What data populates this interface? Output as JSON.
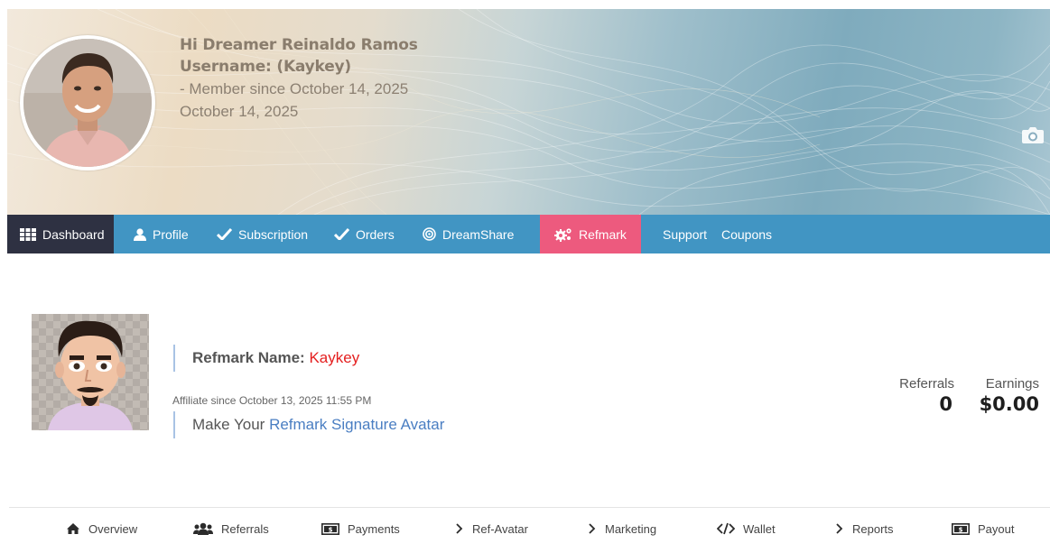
{
  "header": {
    "greeting": "Hi Dreamer Reinaldo  Ramos",
    "username": "Username: (Kaykey)",
    "member_since": "- Member since October 14, 2025",
    "date": "October 14, 2025"
  },
  "nav": {
    "items": [
      {
        "label": "Dashboard",
        "icon": "grid-icon"
      },
      {
        "label": "Profile",
        "icon": "user-icon"
      },
      {
        "label": "Subscription",
        "icon": "check-icon"
      },
      {
        "label": "Orders",
        "icon": "check-icon"
      },
      {
        "label": "DreamShare",
        "icon": "target-icon"
      },
      {
        "label": "Refmark",
        "icon": "cogs-icon"
      },
      {
        "label": "Support"
      },
      {
        "label": "Coupons"
      }
    ],
    "active_color": "#2e3142",
    "bar_color": "#4195c3",
    "refmark_color": "#ed5a7e"
  },
  "affiliate": {
    "name_label": "Refmark Name: ",
    "name_value": "Kaykey",
    "since": "Affiliate since October 13, 2025 11:55 PM",
    "make_prefix": "Make Your ",
    "make_link": "Refmark Signature Avatar"
  },
  "stats": {
    "referrals_label": "Referrals",
    "referrals_value": "0",
    "earnings_label": "Earnings",
    "earnings_value": "$0.00"
  },
  "subnav": [
    {
      "label": "Overview",
      "icon": "home-icon"
    },
    {
      "label": "Referrals",
      "icon": "users-icon"
    },
    {
      "label": "Payments",
      "icon": "money-icon"
    },
    {
      "label": "Ref-Avatar",
      "icon": "chevron-right-icon"
    },
    {
      "label": "Marketing",
      "icon": "chevron-right-icon"
    },
    {
      "label": "Wallet",
      "icon": "code-icon"
    },
    {
      "label": "Reports",
      "icon": "chevron-right-icon"
    },
    {
      "label": "Payout",
      "icon": "money-icon"
    }
  ]
}
